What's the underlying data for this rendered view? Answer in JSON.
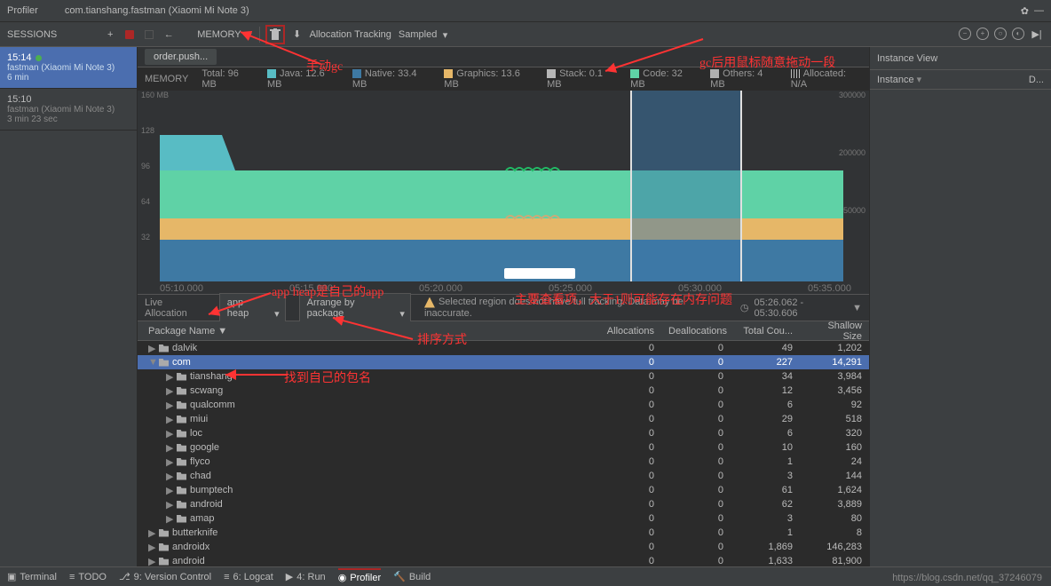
{
  "topbar": {
    "tab": "Profiler",
    "project": "com.tianshang.fastman (Xiaomi Mi Note 3)"
  },
  "toolbar": {
    "sessions_label": "SESSIONS",
    "memory_label": "MEMORY",
    "alloc_tracking": "Allocation Tracking",
    "sampled": "Sampled"
  },
  "sessions": {
    "items": [
      {
        "time": "15:14",
        "sub": "fastman (Xiaomi Mi Note 3)",
        "dur": "6 min",
        "live": true
      },
      {
        "time": "15:10",
        "sub": "fastman (Xiaomi Mi Note 3)",
        "dur": "3 min 23 sec",
        "live": false
      }
    ]
  },
  "breadcrumb": {
    "val": "order.push..."
  },
  "legend": {
    "memory": "MEMORY",
    "max": "160 MB",
    "total": "Total: 96 MB",
    "java": "Java: 12.6 MB",
    "native": "Native: 33.4 MB",
    "graphics": "Graphics: 13.6 MB",
    "stack": "Stack: 0.1 MB",
    "code": "Code: 32 MB",
    "others": "Others: 4 MB",
    "allocated": "Allocated: N/A"
  },
  "chart_data": {
    "type": "area",
    "x": [
      "05:10.000",
      "05:15.000",
      "05:20.000",
      "05:25.000",
      "05:30.000",
      "05:35.000"
    ],
    "ylim": [
      0,
      160
    ],
    "right_ylim": [
      0,
      300000
    ],
    "y_ticks": [
      32,
      64,
      96,
      128
    ],
    "right_y_ticks": [
      150000,
      200000,
      300000
    ],
    "series": [
      {
        "name": "Code",
        "color": "#5fd2a6",
        "values": [
          32,
          32,
          32,
          32,
          32,
          32
        ]
      },
      {
        "name": "Graphics",
        "color": "#e6b768",
        "values": [
          14,
          14,
          13.6,
          13.6,
          13.6,
          13.6
        ]
      },
      {
        "name": "Native",
        "color": "#3e79a3",
        "values": [
          34,
          34,
          33.4,
          33.4,
          33.4,
          33.4
        ]
      },
      {
        "name": "Java",
        "color": "#58bcc4",
        "values": [
          34,
          20,
          12.6,
          12.6,
          12.6,
          12.6
        ]
      },
      {
        "name": "Stack",
        "color": "#b6b6b6",
        "values": [
          0.1,
          0.1,
          0.1,
          0.1,
          0.1,
          0.1
        ]
      },
      {
        "name": "Others",
        "color": "#afafaf",
        "values": [
          4,
          4,
          4,
          4,
          4,
          4
        ]
      }
    ],
    "selection": {
      "start": "05:26.062",
      "end": "05:30.606"
    }
  },
  "filters": {
    "live": "Live Allocation",
    "heap": "app heap",
    "arrange": "Arrange by package",
    "warning": "Selected region does not have full tracking. Data may be inaccurate.",
    "timestamp": "05:26.062 - 05:30.606"
  },
  "table": {
    "cols": [
      "Package Name",
      "Allocations",
      "Deallocations",
      "Total Cou...",
      "Shallow Size"
    ],
    "rows": [
      {
        "lvl": 0,
        "exp": "▶",
        "name": "dalvik",
        "alloc": 0,
        "dealloc": 0,
        "total": 49,
        "shallow": "1,202"
      },
      {
        "lvl": 0,
        "exp": "▼",
        "name": "com",
        "alloc": 0,
        "dealloc": 0,
        "total": 227,
        "shallow": "14,291",
        "sel": true
      },
      {
        "lvl": 1,
        "exp": "▶",
        "name": "tianshang",
        "alloc": 0,
        "dealloc": 0,
        "total": 34,
        "shallow": "3,984"
      },
      {
        "lvl": 1,
        "exp": "▶",
        "name": "scwang",
        "alloc": 0,
        "dealloc": 0,
        "total": 12,
        "shallow": "3,456"
      },
      {
        "lvl": 1,
        "exp": "▶",
        "name": "qualcomm",
        "alloc": 0,
        "dealloc": 0,
        "total": 6,
        "shallow": "92"
      },
      {
        "lvl": 1,
        "exp": "▶",
        "name": "miui",
        "alloc": 0,
        "dealloc": 0,
        "total": 29,
        "shallow": "518"
      },
      {
        "lvl": 1,
        "exp": "▶",
        "name": "loc",
        "alloc": 0,
        "dealloc": 0,
        "total": 6,
        "shallow": "320"
      },
      {
        "lvl": 1,
        "exp": "▶",
        "name": "google",
        "alloc": 0,
        "dealloc": 0,
        "total": 10,
        "shallow": "160"
      },
      {
        "lvl": 1,
        "exp": "▶",
        "name": "flyco",
        "alloc": 0,
        "dealloc": 0,
        "total": 1,
        "shallow": "24"
      },
      {
        "lvl": 1,
        "exp": "▶",
        "name": "chad",
        "alloc": 0,
        "dealloc": 0,
        "total": 3,
        "shallow": "144"
      },
      {
        "lvl": 1,
        "exp": "▶",
        "name": "bumptech",
        "alloc": 0,
        "dealloc": 0,
        "total": 61,
        "shallow": "1,624"
      },
      {
        "lvl": 1,
        "exp": "▶",
        "name": "android",
        "alloc": 0,
        "dealloc": 0,
        "total": 62,
        "shallow": "3,889"
      },
      {
        "lvl": 1,
        "exp": "▶",
        "name": "amap",
        "alloc": 0,
        "dealloc": 0,
        "total": 3,
        "shallow": "80"
      },
      {
        "lvl": 0,
        "exp": "▶",
        "name": "butterknife",
        "alloc": 0,
        "dealloc": 0,
        "total": 1,
        "shallow": "8"
      },
      {
        "lvl": 0,
        "exp": "▶",
        "name": "androidx",
        "alloc": 0,
        "dealloc": 0,
        "total": "1,869",
        "shallow": "146,283"
      },
      {
        "lvl": 0,
        "exp": "▶",
        "name": "android",
        "alloc": 0,
        "dealloc": 0,
        "total": "1,633",
        "shallow": "81,900"
      }
    ]
  },
  "instance": {
    "title": "Instance View",
    "col": "Instance",
    "col2": "D..."
  },
  "bottombar": {
    "items": [
      "Terminal",
      "TODO",
      "9: Version Control",
      "6: Logcat",
      "4: Run",
      "Profiler",
      "Build"
    ],
    "url": "https://blog.csdn.net/qq_37246079"
  },
  "annotations": {
    "a1": "手动gc",
    "a2": "gc后用鼠标随意拖动一段",
    "a3": "app heap是自己的app",
    "a4": "主要查看项，大于1则可能存在内存问题",
    "a5": "排序方式",
    "a6": "找到自己的包名"
  }
}
